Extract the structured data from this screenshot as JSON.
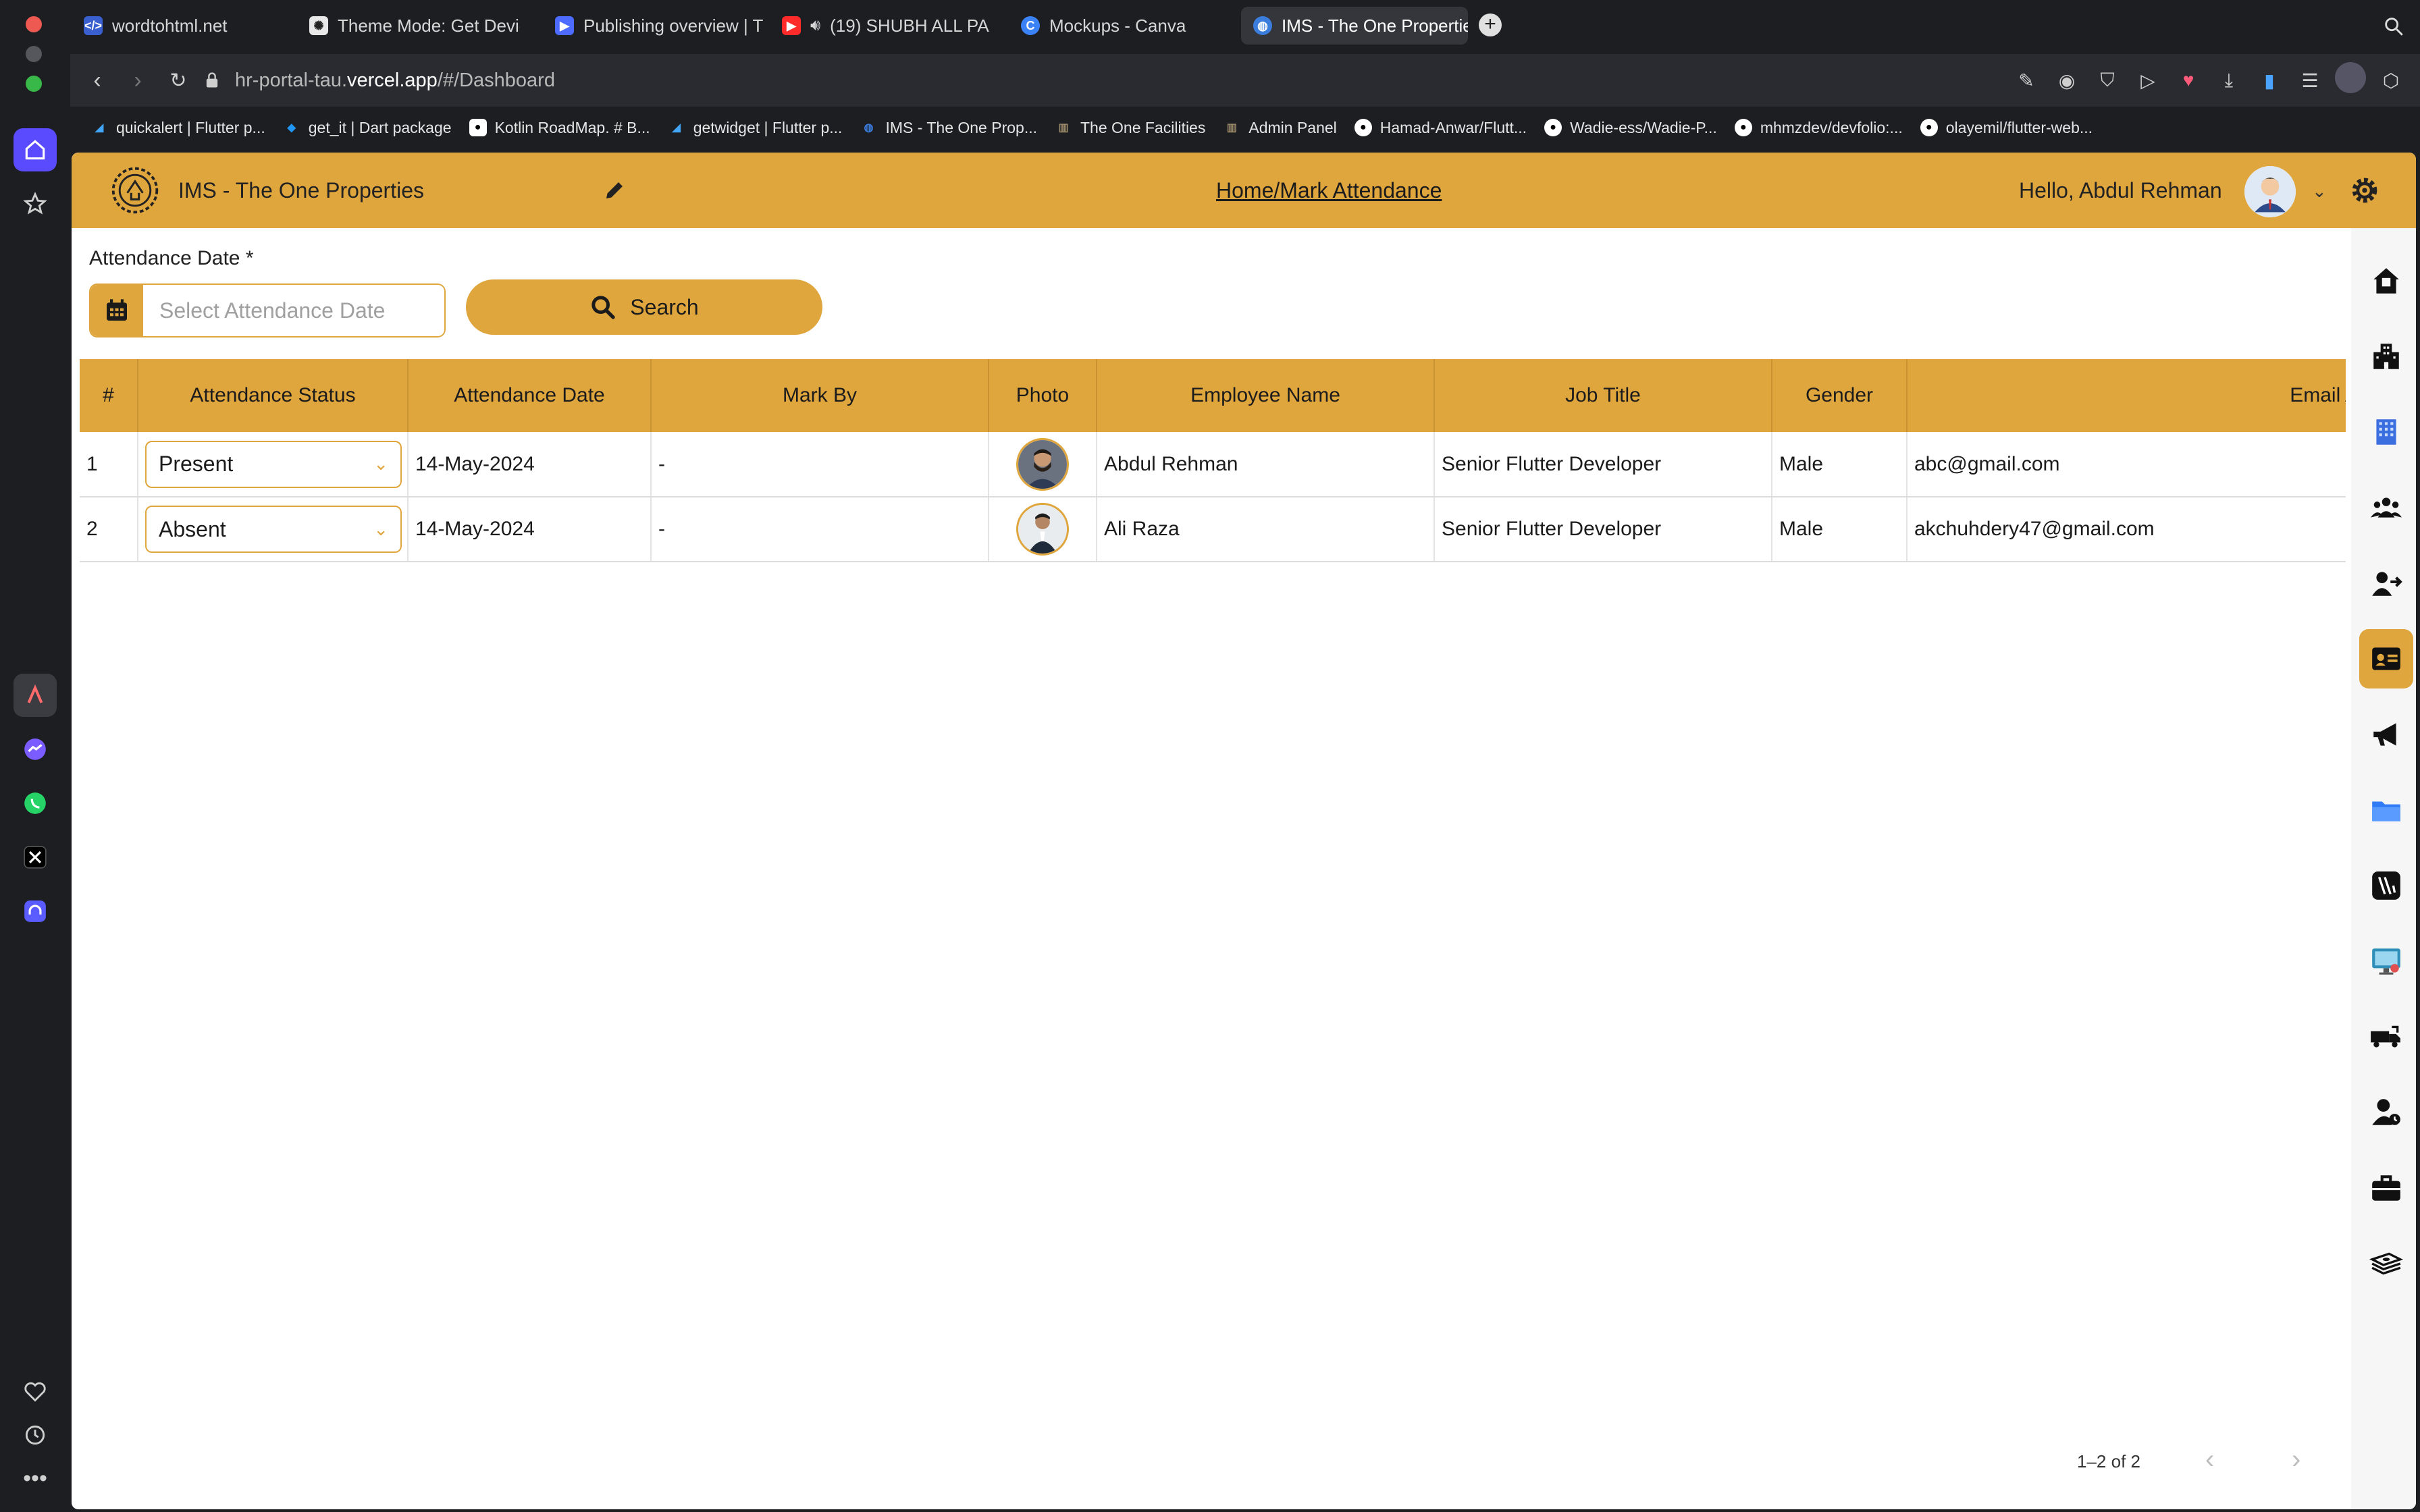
{
  "browser": {
    "tabs": [
      {
        "label": "wordtohtml.net",
        "favicon_color": "#3a5fcf"
      },
      {
        "label": "Theme Mode: Get Devic",
        "favicon_color": "#e8e8e8"
      },
      {
        "label": "Publishing overview | Th",
        "favicon_color": "#4d6bff"
      },
      {
        "label": "(19) SHUBH ALL PA",
        "favicon_color": "#ff2a2a"
      },
      {
        "label": "Mockups - Canva",
        "favicon_color": "#3b82f6"
      },
      {
        "label": "IMS - The One Propertie",
        "favicon_color": "#3b7ddd",
        "active": true
      }
    ],
    "url_host_prefix": "hr-portal-tau.",
    "url_host_main": "vercel.app",
    "url_path": "/#/Dashboard",
    "bookmarks": [
      {
        "label": "quickalert | Flutter p...",
        "icon_color": "#42a5f5"
      },
      {
        "label": "get_it | Dart package",
        "icon_color": "#2196f3"
      },
      {
        "label": "Kotlin RoadMap. # B...",
        "icon_color": "#ffffff"
      },
      {
        "label": "getwidget | Flutter p...",
        "icon_color": "#42a5f5"
      },
      {
        "label": "IMS - The One Prop...",
        "icon_color": "#3b7ddd"
      },
      {
        "label": "The One Facilities",
        "icon_color": "#9a8a6a"
      },
      {
        "label": "Admin Panel",
        "icon_color": "#9a8a6a"
      },
      {
        "label": "Hamad-Anwar/Flutt...",
        "icon_color": "#ffffff"
      },
      {
        "label": "Wadie-ess/Wadie-P...",
        "icon_color": "#ffffff"
      },
      {
        "label": "mhmzdev/devfolio:...",
        "icon_color": "#ffffff"
      },
      {
        "label": "olayemil/flutter-web...",
        "icon_color": "#ffffff"
      }
    ]
  },
  "header": {
    "app_title": "IMS - The One Properties",
    "breadcrumb": "Home/Mark Attendance",
    "greeting": "Hello, Abdul Rehman"
  },
  "form": {
    "date_label": "Attendance Date *",
    "date_placeholder": "Select Attendance Date",
    "search_label": "Search"
  },
  "table": {
    "columns": [
      "#",
      "Attendance Status",
      "Attendance Date",
      "Mark By",
      "Photo",
      "Employee Name",
      "Job Title",
      "Gender",
      "Email Address"
    ],
    "rows": [
      {
        "index": "1",
        "status": "Present",
        "date": "14-May-2024",
        "mark_by": "-",
        "name": "Abdul Rehman",
        "job_title": "Senior Flutter Developer",
        "gender": "Male",
        "email": "abc@gmail.com"
      },
      {
        "index": "2",
        "status": "Absent",
        "date": "14-May-2024",
        "mark_by": "-",
        "name": "Ali Raza",
        "job_title": "Senior Flutter Developer",
        "gender": "Male",
        "email": "akchuhdery47@gmail.com"
      }
    ]
  },
  "pagination": {
    "range": "1–2 of 2"
  },
  "colors": {
    "accent": "#e0a63e",
    "chrome": "#1d1e22"
  },
  "right_nav_icons": [
    "home-icon",
    "building-icon",
    "office-icon",
    "team-icon",
    "user-transfer-icon",
    "id-card-icon",
    "megaphone-icon",
    "folder-icon",
    "wallet-icon",
    "monitor-icon",
    "truck-icon",
    "user-clock-icon",
    "briefcase-icon",
    "money-stack-icon"
  ]
}
